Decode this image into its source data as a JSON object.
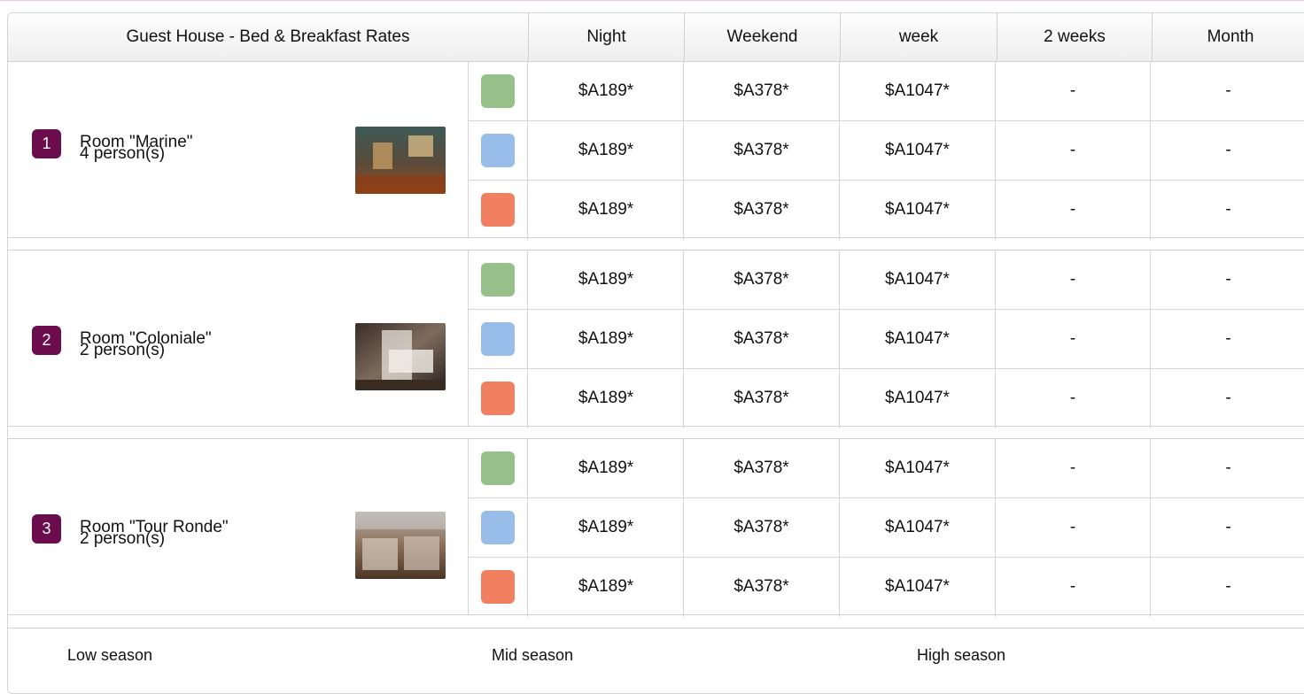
{
  "table": {
    "title": "Guest House - Bed & Breakfast Rates",
    "columns": [
      "Night",
      "Weekend",
      "week",
      "2 weeks",
      "Month"
    ],
    "colors": {
      "low": "#97c08b",
      "mid": "#98bde9",
      "high": "#f0805f",
      "badge": "#6b0d4c"
    },
    "rooms": [
      {
        "number": "1",
        "name": "Room \"Marine\"",
        "capacity": "4 person(s)",
        "photo": "room-photo-marine",
        "rates": [
          {
            "season": "low",
            "values": [
              "$A189*",
              "$A378*",
              "$A1047*",
              "-",
              "-"
            ]
          },
          {
            "season": "mid",
            "values": [
              "$A189*",
              "$A378*",
              "$A1047*",
              "-",
              "-"
            ]
          },
          {
            "season": "high",
            "values": [
              "$A189*",
              "$A378*",
              "$A1047*",
              "-",
              "-"
            ]
          }
        ]
      },
      {
        "number": "2",
        "name": "Room \"Coloniale\"",
        "capacity": "2 person(s)",
        "photo": "room-photo-coloniale",
        "rates": [
          {
            "season": "low",
            "values": [
              "$A189*",
              "$A378*",
              "$A1047*",
              "-",
              "-"
            ]
          },
          {
            "season": "mid",
            "values": [
              "$A189*",
              "$A378*",
              "$A1047*",
              "-",
              "-"
            ]
          },
          {
            "season": "high",
            "values": [
              "$A189*",
              "$A378*",
              "$A1047*",
              "-",
              "-"
            ]
          }
        ]
      },
      {
        "number": "3",
        "name": "Room \"Tour Ronde\"",
        "capacity": "2 person(s)",
        "photo": "room-photo-tour-ronde",
        "rates": [
          {
            "season": "low",
            "values": [
              "$A189*",
              "$A378*",
              "$A1047*",
              "-",
              "-"
            ]
          },
          {
            "season": "mid",
            "values": [
              "$A189*",
              "$A378*",
              "$A1047*",
              "-",
              "-"
            ]
          },
          {
            "season": "high",
            "values": [
              "$A189*",
              "$A378*",
              "$A1047*",
              "-",
              "-"
            ]
          }
        ]
      }
    ]
  },
  "legend": {
    "low_label": "Low season",
    "mid_label": "Mid season",
    "high_label": "High season"
  }
}
